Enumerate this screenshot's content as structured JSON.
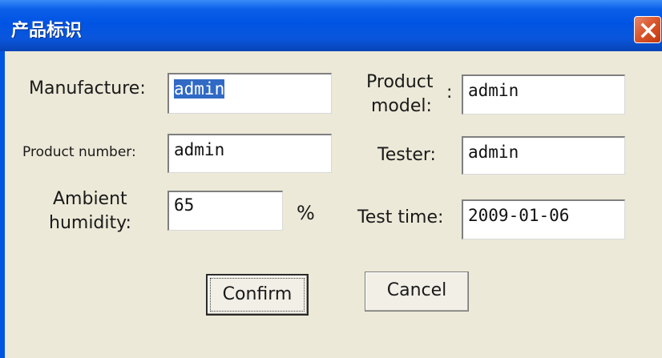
{
  "window": {
    "title": "产品标识",
    "close_icon": "close-icon",
    "titlebar_color": "#0054e3",
    "background": "#ece9d8"
  },
  "form": {
    "manufacture_label": "Manufacture:",
    "manufacture_value": "admin",
    "product_model_label_1": "Product",
    "product_model_label_2": "model:",
    "product_model_colon": ":",
    "product_model_value": "admin",
    "product_number_label": "Product number:",
    "product_number_value": "admin",
    "tester_label": "Tester:",
    "tester_value": "admin",
    "humidity_label_1": "Ambient",
    "humidity_label_2": "humidity:",
    "humidity_value": "65",
    "humidity_unit": "%",
    "test_time_label": "Test time:",
    "test_time_value": "2009-01-06"
  },
  "buttons": {
    "confirm_label": "Confirm",
    "cancel_label": "Cancel"
  },
  "selection_color": "#316ac5"
}
